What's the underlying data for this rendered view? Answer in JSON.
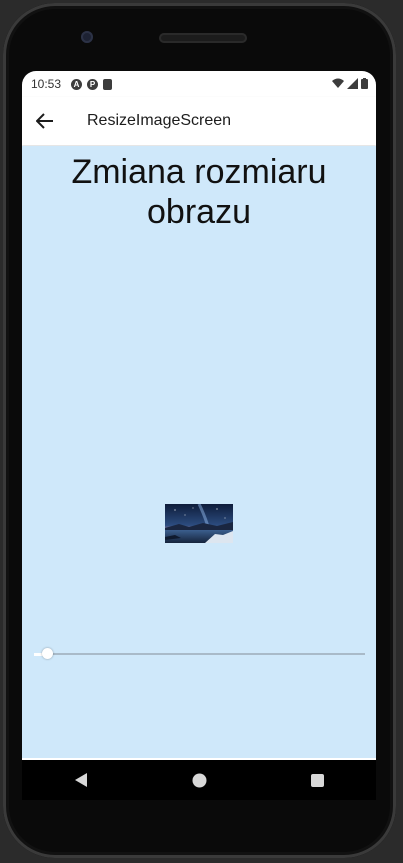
{
  "status": {
    "time": "10:53",
    "icons": [
      "a-icon",
      "p-icon",
      "sd-card-icon"
    ],
    "right_icons": [
      "wifi-icon",
      "signal-icon",
      "battery-icon"
    ]
  },
  "appbar": {
    "title": "ResizeImageScreen",
    "back_icon": "arrow-back-icon"
  },
  "main": {
    "heading": "Zmiana rozmiaru obrazu",
    "background": "#cfe8fa",
    "image": {
      "description_icon": "night-sky-lake-image"
    },
    "slider": {
      "value": 0.04
    }
  },
  "nav": {
    "buttons": [
      "back-triangle-icon",
      "home-circle-icon",
      "recents-square-icon"
    ]
  }
}
